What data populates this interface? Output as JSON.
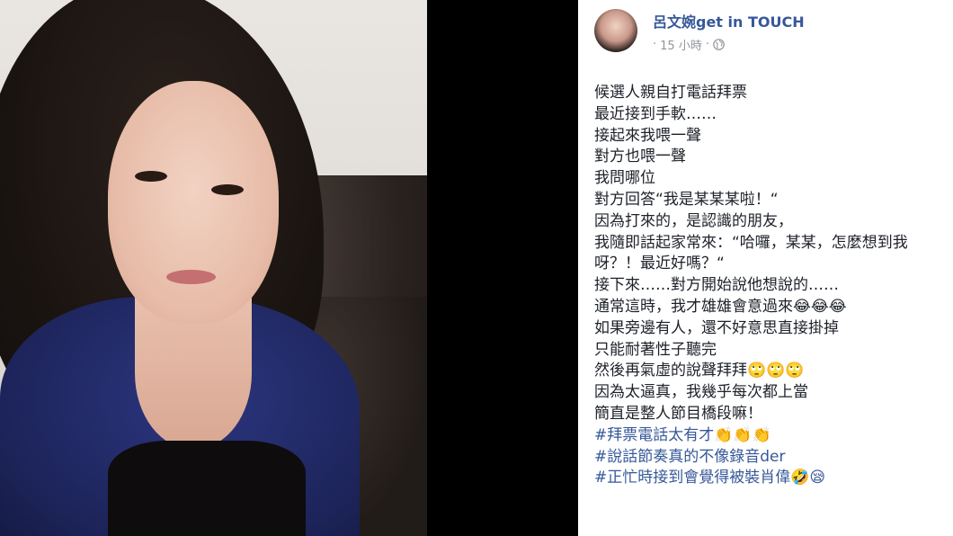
{
  "author": {
    "name": "呂文婉get in TOUCH",
    "time": "15 小時",
    "privacy_icon": "globe-icon"
  },
  "post": {
    "lines": [
      "候選人親自打電話拜票",
      "最近接到手軟……",
      "接起來我喂一聲",
      "對方也喂一聲",
      "我問哪位",
      "對方回答“我是某某某啦！“",
      "因為打來的，是認識的朋友，",
      "我隨即話起家常來：“哈囉，某某，怎麼想到我呀？！最近好嗎？“",
      "接下來……對方開始說他想說的……",
      "通常這時，我才雄雄會意過來😂😂😂",
      "如果旁邊有人，還不好意思直接掛掉",
      "只能耐著性子聽完",
      "然後再氣虛的說聲拜拜🙄🙄🙄",
      "因為太逼真，我幾乎每次都上當",
      "簡直是整人節目橋段嘛！"
    ],
    "hashtags": [
      "#拜票電話太有才👏👏👏",
      "#說話節奏真的不像錄音der",
      "#正忙時接到會覺得被裝肖偉🤣😪"
    ]
  },
  "colors": {
    "link": "#365899",
    "text": "#1d2129",
    "meta": "#90949c"
  }
}
